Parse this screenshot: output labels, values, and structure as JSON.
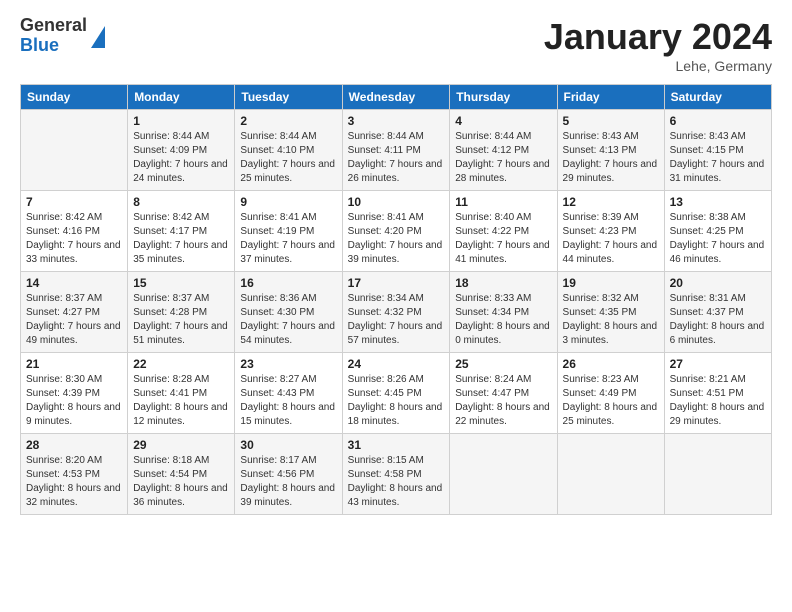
{
  "header": {
    "logo_general": "General",
    "logo_blue": "Blue",
    "month_title": "January 2024",
    "location": "Lehe, Germany"
  },
  "weekdays": [
    "Sunday",
    "Monday",
    "Tuesday",
    "Wednesday",
    "Thursday",
    "Friday",
    "Saturday"
  ],
  "weeks": [
    [
      {
        "day": "",
        "sunrise": "",
        "sunset": "",
        "daylight": ""
      },
      {
        "day": "1",
        "sunrise": "Sunrise: 8:44 AM",
        "sunset": "Sunset: 4:09 PM",
        "daylight": "Daylight: 7 hours and 24 minutes."
      },
      {
        "day": "2",
        "sunrise": "Sunrise: 8:44 AM",
        "sunset": "Sunset: 4:10 PM",
        "daylight": "Daylight: 7 hours and 25 minutes."
      },
      {
        "day": "3",
        "sunrise": "Sunrise: 8:44 AM",
        "sunset": "Sunset: 4:11 PM",
        "daylight": "Daylight: 7 hours and 26 minutes."
      },
      {
        "day": "4",
        "sunrise": "Sunrise: 8:44 AM",
        "sunset": "Sunset: 4:12 PM",
        "daylight": "Daylight: 7 hours and 28 minutes."
      },
      {
        "day": "5",
        "sunrise": "Sunrise: 8:43 AM",
        "sunset": "Sunset: 4:13 PM",
        "daylight": "Daylight: 7 hours and 29 minutes."
      },
      {
        "day": "6",
        "sunrise": "Sunrise: 8:43 AM",
        "sunset": "Sunset: 4:15 PM",
        "daylight": "Daylight: 7 hours and 31 minutes."
      }
    ],
    [
      {
        "day": "7",
        "sunrise": "Sunrise: 8:42 AM",
        "sunset": "Sunset: 4:16 PM",
        "daylight": "Daylight: 7 hours and 33 minutes."
      },
      {
        "day": "8",
        "sunrise": "Sunrise: 8:42 AM",
        "sunset": "Sunset: 4:17 PM",
        "daylight": "Daylight: 7 hours and 35 minutes."
      },
      {
        "day": "9",
        "sunrise": "Sunrise: 8:41 AM",
        "sunset": "Sunset: 4:19 PM",
        "daylight": "Daylight: 7 hours and 37 minutes."
      },
      {
        "day": "10",
        "sunrise": "Sunrise: 8:41 AM",
        "sunset": "Sunset: 4:20 PM",
        "daylight": "Daylight: 7 hours and 39 minutes."
      },
      {
        "day": "11",
        "sunrise": "Sunrise: 8:40 AM",
        "sunset": "Sunset: 4:22 PM",
        "daylight": "Daylight: 7 hours and 41 minutes."
      },
      {
        "day": "12",
        "sunrise": "Sunrise: 8:39 AM",
        "sunset": "Sunset: 4:23 PM",
        "daylight": "Daylight: 7 hours and 44 minutes."
      },
      {
        "day": "13",
        "sunrise": "Sunrise: 8:38 AM",
        "sunset": "Sunset: 4:25 PM",
        "daylight": "Daylight: 7 hours and 46 minutes."
      }
    ],
    [
      {
        "day": "14",
        "sunrise": "Sunrise: 8:37 AM",
        "sunset": "Sunset: 4:27 PM",
        "daylight": "Daylight: 7 hours and 49 minutes."
      },
      {
        "day": "15",
        "sunrise": "Sunrise: 8:37 AM",
        "sunset": "Sunset: 4:28 PM",
        "daylight": "Daylight: 7 hours and 51 minutes."
      },
      {
        "day": "16",
        "sunrise": "Sunrise: 8:36 AM",
        "sunset": "Sunset: 4:30 PM",
        "daylight": "Daylight: 7 hours and 54 minutes."
      },
      {
        "day": "17",
        "sunrise": "Sunrise: 8:34 AM",
        "sunset": "Sunset: 4:32 PM",
        "daylight": "Daylight: 7 hours and 57 minutes."
      },
      {
        "day": "18",
        "sunrise": "Sunrise: 8:33 AM",
        "sunset": "Sunset: 4:34 PM",
        "daylight": "Daylight: 8 hours and 0 minutes."
      },
      {
        "day": "19",
        "sunrise": "Sunrise: 8:32 AM",
        "sunset": "Sunset: 4:35 PM",
        "daylight": "Daylight: 8 hours and 3 minutes."
      },
      {
        "day": "20",
        "sunrise": "Sunrise: 8:31 AM",
        "sunset": "Sunset: 4:37 PM",
        "daylight": "Daylight: 8 hours and 6 minutes."
      }
    ],
    [
      {
        "day": "21",
        "sunrise": "Sunrise: 8:30 AM",
        "sunset": "Sunset: 4:39 PM",
        "daylight": "Daylight: 8 hours and 9 minutes."
      },
      {
        "day": "22",
        "sunrise": "Sunrise: 8:28 AM",
        "sunset": "Sunset: 4:41 PM",
        "daylight": "Daylight: 8 hours and 12 minutes."
      },
      {
        "day": "23",
        "sunrise": "Sunrise: 8:27 AM",
        "sunset": "Sunset: 4:43 PM",
        "daylight": "Daylight: 8 hours and 15 minutes."
      },
      {
        "day": "24",
        "sunrise": "Sunrise: 8:26 AM",
        "sunset": "Sunset: 4:45 PM",
        "daylight": "Daylight: 8 hours and 18 minutes."
      },
      {
        "day": "25",
        "sunrise": "Sunrise: 8:24 AM",
        "sunset": "Sunset: 4:47 PM",
        "daylight": "Daylight: 8 hours and 22 minutes."
      },
      {
        "day": "26",
        "sunrise": "Sunrise: 8:23 AM",
        "sunset": "Sunset: 4:49 PM",
        "daylight": "Daylight: 8 hours and 25 minutes."
      },
      {
        "day": "27",
        "sunrise": "Sunrise: 8:21 AM",
        "sunset": "Sunset: 4:51 PM",
        "daylight": "Daylight: 8 hours and 29 minutes."
      }
    ],
    [
      {
        "day": "28",
        "sunrise": "Sunrise: 8:20 AM",
        "sunset": "Sunset: 4:53 PM",
        "daylight": "Daylight: 8 hours and 32 minutes."
      },
      {
        "day": "29",
        "sunrise": "Sunrise: 8:18 AM",
        "sunset": "Sunset: 4:54 PM",
        "daylight": "Daylight: 8 hours and 36 minutes."
      },
      {
        "day": "30",
        "sunrise": "Sunrise: 8:17 AM",
        "sunset": "Sunset: 4:56 PM",
        "daylight": "Daylight: 8 hours and 39 minutes."
      },
      {
        "day": "31",
        "sunrise": "Sunrise: 8:15 AM",
        "sunset": "Sunset: 4:58 PM",
        "daylight": "Daylight: 8 hours and 43 minutes."
      },
      {
        "day": "",
        "sunrise": "",
        "sunset": "",
        "daylight": ""
      },
      {
        "day": "",
        "sunrise": "",
        "sunset": "",
        "daylight": ""
      },
      {
        "day": "",
        "sunrise": "",
        "sunset": "",
        "daylight": ""
      }
    ]
  ]
}
